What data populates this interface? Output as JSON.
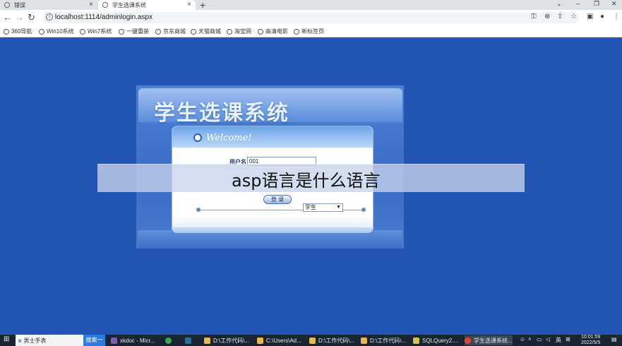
{
  "browser": {
    "tabs": [
      {
        "label": "错误",
        "active": false
      },
      {
        "label": "学生选课系统",
        "active": true
      }
    ],
    "new_tab": "+",
    "window_controls": {
      "minimize": "⌄",
      "restore": "–",
      "maximize": "❐",
      "close": "✕"
    },
    "url": "localhost:1114/adminlogin.aspx",
    "bookmarks": [
      "360导航",
      "Win10系统",
      "Win7系统",
      "一键重装",
      "京东商城",
      "天猫商城",
      "淘宝网",
      "高清电影",
      "新标签页"
    ]
  },
  "login": {
    "system_title": "学生选课系统",
    "welcome": "Welcome!",
    "username_label": "用户名:",
    "username_value": "001",
    "login_button": "登 录",
    "role_selected": "学生"
  },
  "overlay": {
    "caption": "asp语言是什么语言"
  },
  "taskbar": {
    "search_text": "男士手表",
    "search_button": "搜索一下",
    "tasks": [
      {
        "label": "xkdoc - Micr...",
        "color": "#7b5ab8"
      },
      {
        "label": "",
        "color": "#3aa757"
      },
      {
        "label": "",
        "color": "#2b6f9a"
      },
      {
        "label": "D:\\工作代码\\...",
        "color": "#e8b84a"
      },
      {
        "label": "C:\\Users\\Ad...",
        "color": "#e8b84a"
      },
      {
        "label": "D:\\工作代码\\...",
        "color": "#e8b84a"
      },
      {
        "label": "D:\\工作代码\\...",
        "color": "#e8b84a"
      },
      {
        "label": "SQLQuery2....",
        "color": "#d6c24a"
      },
      {
        "label": "学生选课系统...",
        "color": "#e0453a"
      }
    ],
    "tray_lang": "英",
    "time": "10:01:59",
    "date": "2022/5/5"
  }
}
